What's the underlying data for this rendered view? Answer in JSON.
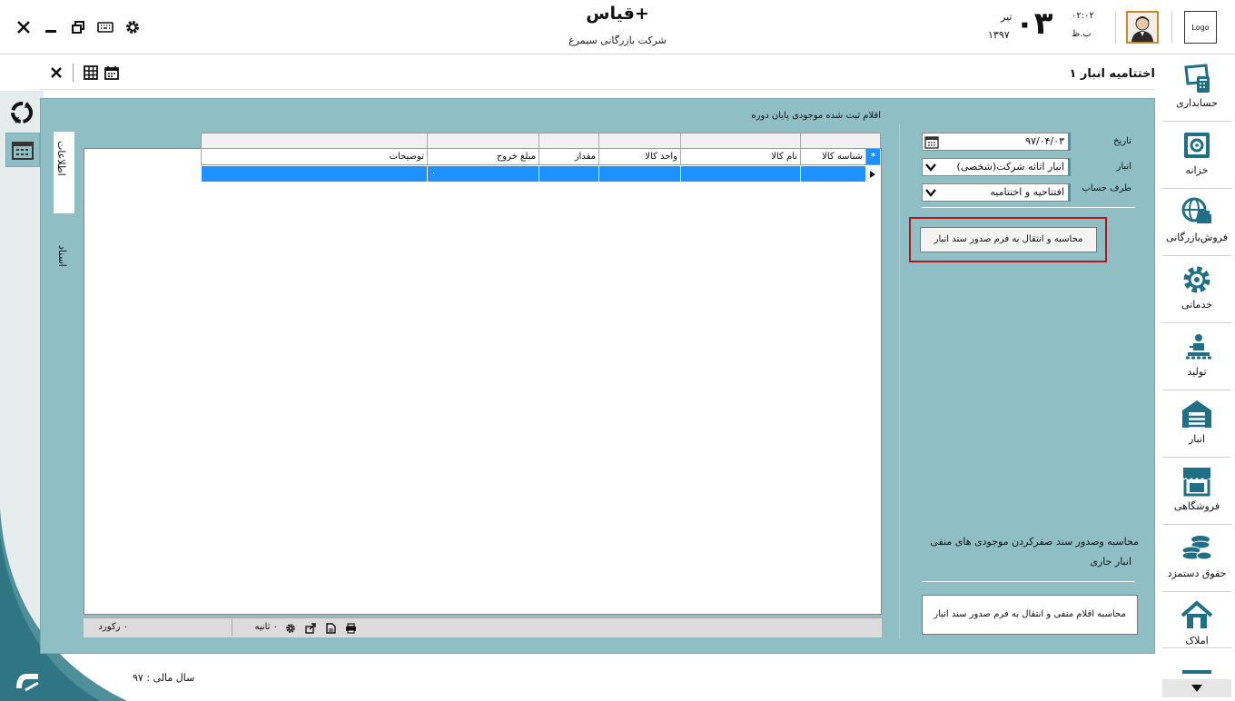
{
  "header": {
    "app_title": "قیاس+",
    "company": "شرکت بازرگانی سیمرغ",
    "date_day": "۰۳",
    "date_month": "تیر",
    "date_year": "۱۳۹۷",
    "time": "۰۲:۰۲",
    "ampm": "ب.ظ",
    "logo_label": "Logo"
  },
  "toolbar": {
    "form_title": "اختتامیه انبار ۱"
  },
  "nav": {
    "items": [
      {
        "label": "حسابداری",
        "icon": "accounting-icon"
      },
      {
        "label": "خزانه",
        "icon": "safe-icon"
      },
      {
        "label": "فروش‌بازرگانی",
        "icon": "globe-trade-icon"
      },
      {
        "label": "خدماتی",
        "icon": "gear-service-icon"
      },
      {
        "label": "تولید",
        "icon": "production-icon"
      },
      {
        "label": "انبار",
        "icon": "warehouse-icon"
      },
      {
        "label": "فروشگاهی",
        "icon": "store-icon"
      },
      {
        "label": "حقوق دستمزد",
        "icon": "coins-icon"
      },
      {
        "label": "املاک",
        "icon": "property-icon"
      }
    ]
  },
  "side_tabs": {
    "info": "اطلاعات",
    "docs": "اسناد"
  },
  "grid": {
    "caption": "اقلام ثبت شده موجودی پایان دوره",
    "columns": [
      "شناسه کالا",
      "نام کالا",
      "واحد کالا",
      "مقدار",
      "مبلغ خروج",
      "توضیحات"
    ],
    "new_row_marker": "*",
    "new_row_value": "۰",
    "footer_records": "۰ رکورد",
    "footer_seconds": "۰ ثانیه"
  },
  "form": {
    "date_label": "تاریخ",
    "date_value": "۹۷/۰۴/۰۳",
    "warehouse_label": "انبار",
    "warehouse_value": "انبار اثاثه شرکت(شخصی)",
    "account_label": "طرف حساب",
    "account_value": "افتتاحیه و اختتامیه",
    "calc_button": "محاسبه و انتقال به فرم صدور سند انبار",
    "neg_desc_line1": "محاسبه وصدور سند صفرکردن موجودی های منفی",
    "neg_desc_line2": "انبار جاری",
    "neg_button": "محاسبه اقلام منفی و انتقال به فرم صدور سند انبار"
  },
  "status": {
    "fiscal_year": "سال مالی : ۹۷"
  },
  "colors": {
    "panel": "#8fbfc4",
    "selection": "#1e90ff",
    "highlight_border": "#b0181e",
    "nav_icon": "#1f6f86"
  }
}
